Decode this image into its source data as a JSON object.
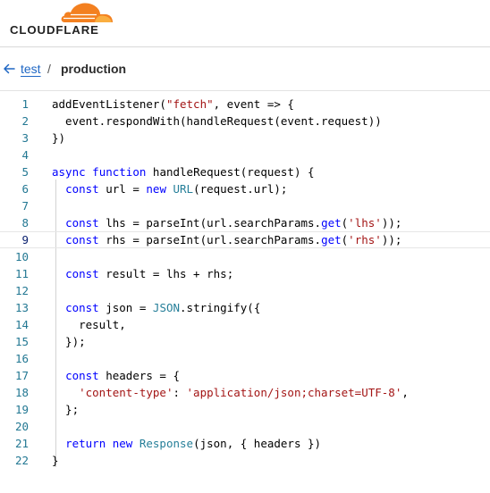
{
  "brand": {
    "name": "CLOUDFLARE",
    "logo_icon": "cloudflare-cloud-icon",
    "colors": {
      "orange": "#f38020",
      "light_orange": "#faae40",
      "text": "#222222"
    }
  },
  "breadcrumb": {
    "back_icon": "arrow-left-icon",
    "parent": "test",
    "separator": "/",
    "current": "production"
  },
  "editor": {
    "active_line": 9,
    "lines": [
      {
        "n": "1",
        "tokens": [
          {
            "t": "addEventListener("
          },
          {
            "t": "\"fetch\"",
            "c": "str"
          },
          {
            "t": ", event => {"
          }
        ]
      },
      {
        "n": "2",
        "tokens": [
          {
            "t": "  event.respondWith(handleRequest(event.request))"
          }
        ]
      },
      {
        "n": "3",
        "tokens": [
          {
            "t": "})"
          }
        ]
      },
      {
        "n": "4",
        "tokens": []
      },
      {
        "n": "5",
        "tokens": [
          {
            "t": "async",
            "c": "kw"
          },
          {
            "t": " "
          },
          {
            "t": "function",
            "c": "kw"
          },
          {
            "t": " handleRequest(request) {"
          }
        ]
      },
      {
        "n": "6",
        "tokens": [
          {
            "t": "  "
          },
          {
            "t": "const",
            "c": "kw"
          },
          {
            "t": " url = "
          },
          {
            "t": "new",
            "c": "kw"
          },
          {
            "t": " "
          },
          {
            "t": "URL",
            "c": "cls"
          },
          {
            "t": "(request.url);"
          }
        ]
      },
      {
        "n": "7",
        "tokens": []
      },
      {
        "n": "8",
        "tokens": [
          {
            "t": "  "
          },
          {
            "t": "const",
            "c": "kw"
          },
          {
            "t": " lhs = parseInt(url.searchParams."
          },
          {
            "t": "get",
            "c": "kw"
          },
          {
            "t": "("
          },
          {
            "t": "'lhs'",
            "c": "str"
          },
          {
            "t": "));"
          }
        ]
      },
      {
        "n": "9",
        "tokens": [
          {
            "t": "  "
          },
          {
            "t": "const",
            "c": "kw"
          },
          {
            "t": " rhs = parseInt(url.searchParams."
          },
          {
            "t": "get",
            "c": "kw"
          },
          {
            "t": "("
          },
          {
            "t": "'rhs'",
            "c": "str"
          },
          {
            "t": "));"
          }
        ]
      },
      {
        "n": "10",
        "tokens": []
      },
      {
        "n": "11",
        "tokens": [
          {
            "t": "  "
          },
          {
            "t": "const",
            "c": "kw"
          },
          {
            "t": " result = lhs + rhs;"
          }
        ]
      },
      {
        "n": "12",
        "tokens": []
      },
      {
        "n": "13",
        "tokens": [
          {
            "t": "  "
          },
          {
            "t": "const",
            "c": "kw"
          },
          {
            "t": " json = "
          },
          {
            "t": "JSON",
            "c": "cls"
          },
          {
            "t": ".stringify({"
          }
        ]
      },
      {
        "n": "14",
        "tokens": [
          {
            "t": "    result,"
          }
        ]
      },
      {
        "n": "15",
        "tokens": [
          {
            "t": "  });"
          }
        ]
      },
      {
        "n": "16",
        "tokens": []
      },
      {
        "n": "17",
        "tokens": [
          {
            "t": "  "
          },
          {
            "t": "const",
            "c": "kw"
          },
          {
            "t": " headers = {"
          }
        ]
      },
      {
        "n": "18",
        "tokens": [
          {
            "t": "    "
          },
          {
            "t": "'content-type'",
            "c": "str"
          },
          {
            "t": ": "
          },
          {
            "t": "'application/json;charset=UTF-8'",
            "c": "str"
          },
          {
            "t": ","
          }
        ]
      },
      {
        "n": "19",
        "tokens": [
          {
            "t": "  };"
          }
        ]
      },
      {
        "n": "20",
        "tokens": []
      },
      {
        "n": "21",
        "tokens": [
          {
            "t": "  "
          },
          {
            "t": "return",
            "c": "kw"
          },
          {
            "t": " "
          },
          {
            "t": "new",
            "c": "kw"
          },
          {
            "t": " "
          },
          {
            "t": "Response",
            "c": "cls"
          },
          {
            "t": "(json, { headers })"
          }
        ]
      },
      {
        "n": "22",
        "tokens": [
          {
            "t": "}"
          }
        ]
      }
    ]
  }
}
